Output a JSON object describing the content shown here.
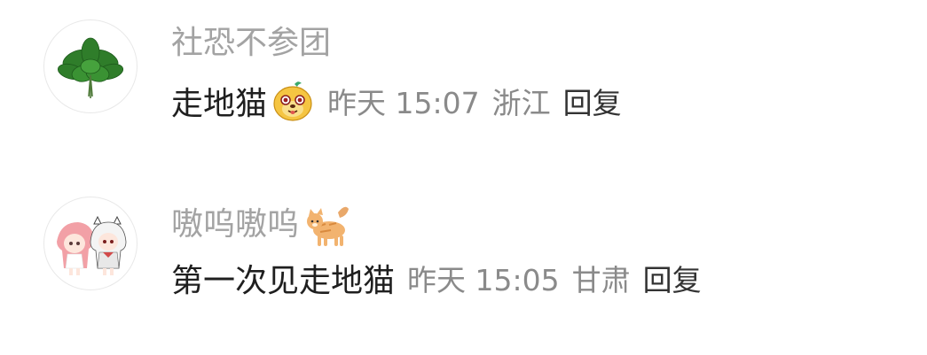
{
  "comments": [
    {
      "username": "社恐不参团",
      "avatar_icon": "basil-leaves-icon",
      "text": "走地猫",
      "sticker_icon": "yellow-doge-sticker",
      "time": "昨天 15:07",
      "location": "浙江",
      "reply_label": "回复"
    },
    {
      "username": "嗷呜嗷呜",
      "username_emoji": "cat-emoji",
      "avatar_icon": "anime-couple-avatar",
      "text": "第一次见走地猫",
      "time": "昨天 15:05",
      "location": "甘肃",
      "reply_label": "回复"
    }
  ]
}
